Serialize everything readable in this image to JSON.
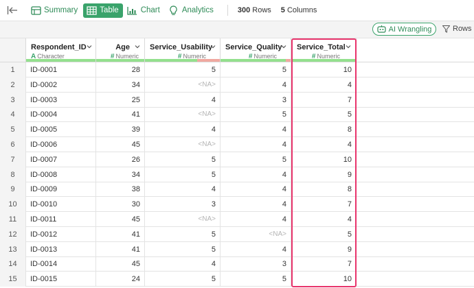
{
  "toolbar": {
    "tabs": [
      {
        "label": "Summary",
        "icon": "summary-icon",
        "active": false
      },
      {
        "label": "Table",
        "icon": "table-icon",
        "active": true
      },
      {
        "label": "Chart",
        "icon": "chart-icon",
        "active": false
      },
      {
        "label": "Analytics",
        "icon": "analytics-icon",
        "active": false
      }
    ],
    "rows_count": "300",
    "rows_word": "Rows",
    "cols_count": "5",
    "cols_word": "Columns"
  },
  "subbar": {
    "ai_label": "AI Wrangling",
    "rows_label": "Rows"
  },
  "columns": [
    {
      "name": "Respondent_ID",
      "type": "Character",
      "type_symbol": "A",
      "na_fraction": 0
    },
    {
      "name": "Age",
      "type": "Numeric",
      "type_symbol": "#",
      "na_fraction": 0
    },
    {
      "name": "Service_Usability",
      "type": "Numeric",
      "type_symbol": "#",
      "na_fraction": 0.3
    },
    {
      "name": "Service_Quality",
      "type": "Numeric",
      "type_symbol": "#",
      "na_fraction": 0.07
    },
    {
      "name": "Service_Total",
      "type": "Numeric",
      "type_symbol": "#",
      "na_fraction": 0
    }
  ],
  "rows": [
    {
      "idx": "1",
      "id": "ID-0001",
      "age": "28",
      "usab": "5",
      "qual": "5",
      "total": "10"
    },
    {
      "idx": "2",
      "id": "ID-0002",
      "age": "34",
      "usab": "<NA>",
      "qual": "4",
      "total": "4"
    },
    {
      "idx": "3",
      "id": "ID-0003",
      "age": "25",
      "usab": "4",
      "qual": "3",
      "total": "7"
    },
    {
      "idx": "4",
      "id": "ID-0004",
      "age": "41",
      "usab": "<NA>",
      "qual": "5",
      "total": "5"
    },
    {
      "idx": "5",
      "id": "ID-0005",
      "age": "39",
      "usab": "4",
      "qual": "4",
      "total": "8"
    },
    {
      "idx": "6",
      "id": "ID-0006",
      "age": "45",
      "usab": "<NA>",
      "qual": "4",
      "total": "4"
    },
    {
      "idx": "7",
      "id": "ID-0007",
      "age": "26",
      "usab": "5",
      "qual": "5",
      "total": "10"
    },
    {
      "idx": "8",
      "id": "ID-0008",
      "age": "34",
      "usab": "5",
      "qual": "4",
      "total": "9"
    },
    {
      "idx": "9",
      "id": "ID-0009",
      "age": "38",
      "usab": "4",
      "qual": "4",
      "total": "8"
    },
    {
      "idx": "10",
      "id": "ID-0010",
      "age": "30",
      "usab": "3",
      "qual": "4",
      "total": "7"
    },
    {
      "idx": "11",
      "id": "ID-0011",
      "age": "45",
      "usab": "<NA>",
      "qual": "4",
      "total": "4"
    },
    {
      "idx": "12",
      "id": "ID-0012",
      "age": "41",
      "usab": "5",
      "qual": "<NA>",
      "total": "5"
    },
    {
      "idx": "13",
      "id": "ID-0013",
      "age": "41",
      "usab": "5",
      "qual": "4",
      "total": "9"
    },
    {
      "idx": "14",
      "id": "ID-0014",
      "age": "45",
      "usab": "4",
      "qual": "3",
      "total": "7"
    },
    {
      "idx": "15",
      "id": "ID-0015",
      "age": "24",
      "usab": "5",
      "qual": "5",
      "total": "10"
    }
  ],
  "colors": {
    "accent": "#3aa36b",
    "highlight": "#e8336b",
    "quality_ok": "#93e08d",
    "quality_na": "#f0a8a0"
  }
}
